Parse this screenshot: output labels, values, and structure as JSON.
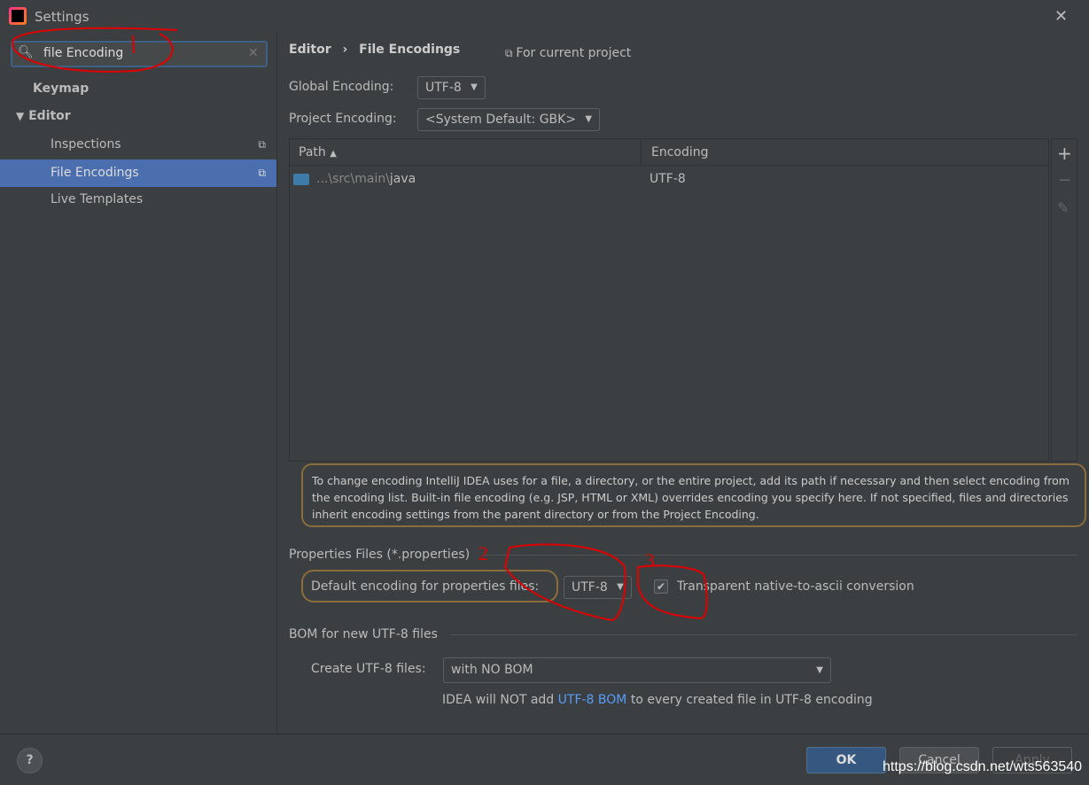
{
  "window": {
    "title": "Settings",
    "close": "✕"
  },
  "search": {
    "value": "file Encoding",
    "clear": "✕"
  },
  "nav": [
    {
      "label": "Keymap"
    },
    {
      "label": "Editor"
    },
    {
      "label": "Inspections"
    },
    {
      "label": "File Encodings"
    },
    {
      "label": "Live Templates"
    }
  ],
  "breadcrumb": {
    "parent": "Editor",
    "sep": "›",
    "current": "File Encodings",
    "scope": "For current project"
  },
  "global": {
    "label": "Global Encoding:",
    "value": "UTF-8"
  },
  "project": {
    "label": "Project Encoding:",
    "value": "<System Default: GBK>"
  },
  "table": {
    "headers": [
      "Path",
      "Encoding"
    ],
    "rows": [
      {
        "path_prefix": "...\\src\\main\\",
        "path_name": "java",
        "encoding": "UTF-8"
      }
    ]
  },
  "toolbar": {
    "add": "+",
    "remove": "−",
    "edit": "✎"
  },
  "info": "To change encoding IntelliJ IDEA uses for a file, a directory, or the entire project, add its path if necessary and then select encoding from the encoding list. Built-in file encoding (e.g. JSP, HTML or XML) overrides encoding you specify here. If not specified, files and directories inherit encoding settings from the parent directory or from the Project Encoding.",
  "props": {
    "section": "Properties Files (*.properties)",
    "label": "Default encoding for properties files:",
    "value": "UTF-8",
    "checkbox_label": "Transparent native-to-ascii conversion",
    "checked": true
  },
  "bom": {
    "section": "BOM for new UTF-8 files",
    "label": "Create UTF-8 files:",
    "value": "with NO BOM",
    "note_pre": "IDEA will NOT add ",
    "note_link": "UTF-8 BOM",
    "note_post": " to every created file in UTF-8 encoding"
  },
  "footer": {
    "help": "?",
    "ok": "OK",
    "cancel": "Cancel",
    "apply": "Apply",
    "watermark": "https://blog.csdn.net/wts563540"
  },
  "annotations": [
    "1",
    "2",
    "3"
  ],
  "colors": {
    "accent": "#4b6eaf",
    "link": "#589df6",
    "annotation": "#e00000"
  }
}
